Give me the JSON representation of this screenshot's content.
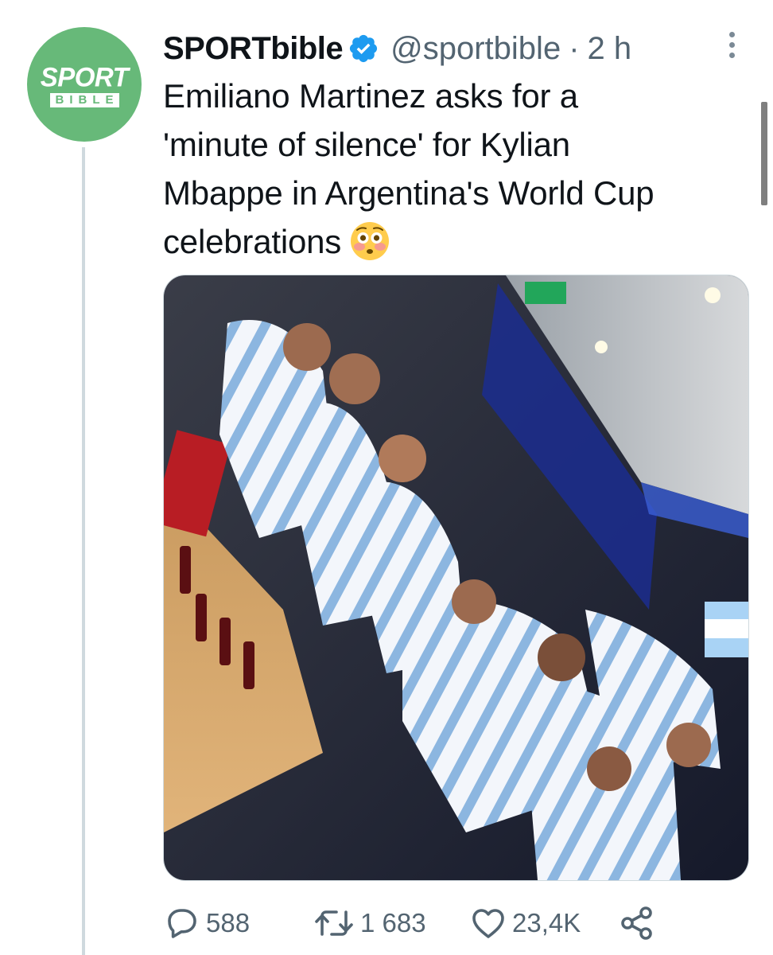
{
  "account": {
    "avatar_text_top": "SPORT",
    "avatar_text_bottom": "BIBLE",
    "display_name": "SPORTbible",
    "handle": "@sportbible",
    "separator": "·",
    "time": "2 h"
  },
  "tweet": {
    "lines": [
      "Emiliano Martinez asks for a",
      "'minute of silence' for Kylian",
      "Mbappe in Argentina's World Cup",
      "celebrations"
    ],
    "emoji": "flushed-face"
  },
  "actions": {
    "replies": "588",
    "retweets": "1 683",
    "likes": "23,4K"
  },
  "colors": {
    "brand_green": "#67b979",
    "verified_blue": "#1d9bf0",
    "secondary_text": "#536471"
  }
}
